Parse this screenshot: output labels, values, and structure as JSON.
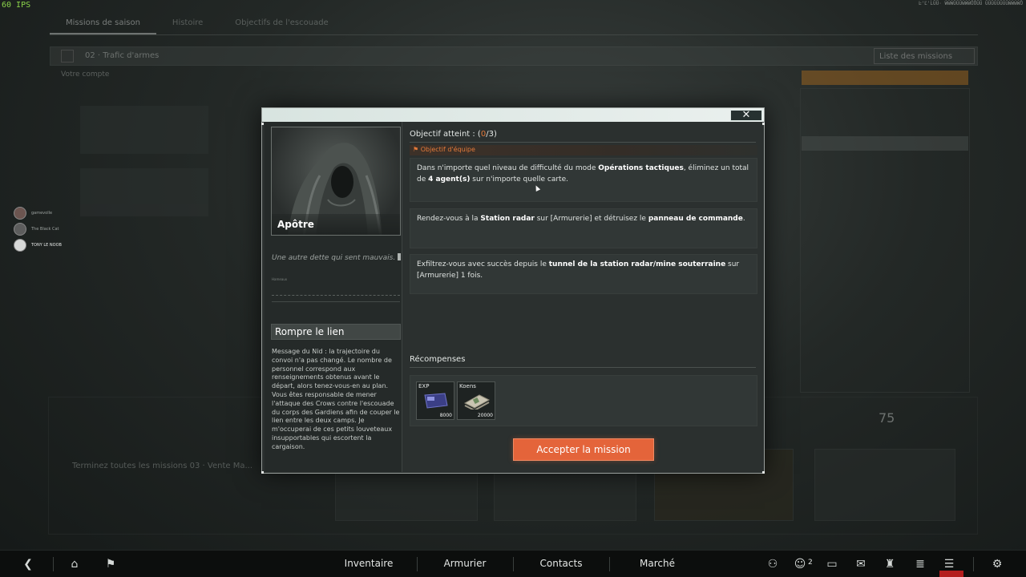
{
  "hud": {
    "fps": "60 IPS",
    "build": "Ŀ'Ľ'ĹŨŨ· ŴŴŴŨŨŨŴŴŴŮŮŨŨ ŨŨŨŨŨŨŨŨŴŴŴŴŮ"
  },
  "background": {
    "tabs": [
      "Missions de saison",
      "Histoire",
      "Objectifs de l'escouade"
    ],
    "header_title": "02 · Trafic d'armes",
    "list_button": "Liste des missions",
    "subtitle": "Votre compte",
    "counter": "75",
    "footer_text": "Terminez toutes les missions 03 · Vente Ma..."
  },
  "players": [
    {
      "name": "gamevolle"
    },
    {
      "name": "The Black Cat"
    },
    {
      "name": "TONY LE NOOB"
    }
  ],
  "modal": {
    "close_label": "✕",
    "character": {
      "name": "Apôtre",
      "tagline": "Une autre dette qui sent mauvais.",
      "graph_label": "Hameaux"
    },
    "mission": {
      "title": "Rompre le lien",
      "description": "Message du Nid : la trajectoire du convoi n'a pas changé. Le nombre de personnel correspond aux renseignements obtenus avant le départ, alors tenez-vous-en au plan. Vous êtes responsable de mener l'attaque des Crows contre l'escouade du corps des Gardiens afin de couper le lien entre les deux camps. Je m'occuperai de ces petits louveteaux insupportables qui escortent la cargaison."
    },
    "objectives": {
      "header_prefix": "Objectif atteint : (",
      "header_done": "0",
      "header_suffix": "/3)",
      "team_label": "Objectif d'équipe",
      "items": [
        {
          "p1": "Dans n'importe quel niveau de difficulté du mode ",
          "b1": "Opérations tactiques",
          "p2": ", éliminez un total de ",
          "b2": "4 agent(s)",
          "p3": " sur n'importe quelle carte."
        },
        {
          "p1": "Rendez-vous à la ",
          "b1": "Station radar",
          "p2": " sur [Armurerie] et détruisez le ",
          "b2": "panneau de commande",
          "p3": "."
        },
        {
          "p1": "Exfiltrez-vous avec succès depuis le ",
          "b1": "tunnel de la station radar/mine souterraine",
          "p2": " sur [Armurerie] 1 fois.",
          "b2": "",
          "p3": ""
        }
      ]
    },
    "rewards": {
      "title": "Récompenses",
      "items": [
        {
          "label": "EXP",
          "amount": "8000",
          "icon": "exp-card-icon"
        },
        {
          "label": "Koens",
          "amount": "20000",
          "icon": "cash-stack-icon"
        }
      ]
    },
    "accept_label": "Accepter la mission"
  },
  "bottom_bar": {
    "nav": [
      "Inventaire",
      "Armurier",
      "Contacts",
      "Marché"
    ],
    "friends_count": "2"
  },
  "colors": {
    "accent": "#e4643a",
    "objective_highlight": "#e3793a",
    "topbar": "#d8e4e0"
  }
}
